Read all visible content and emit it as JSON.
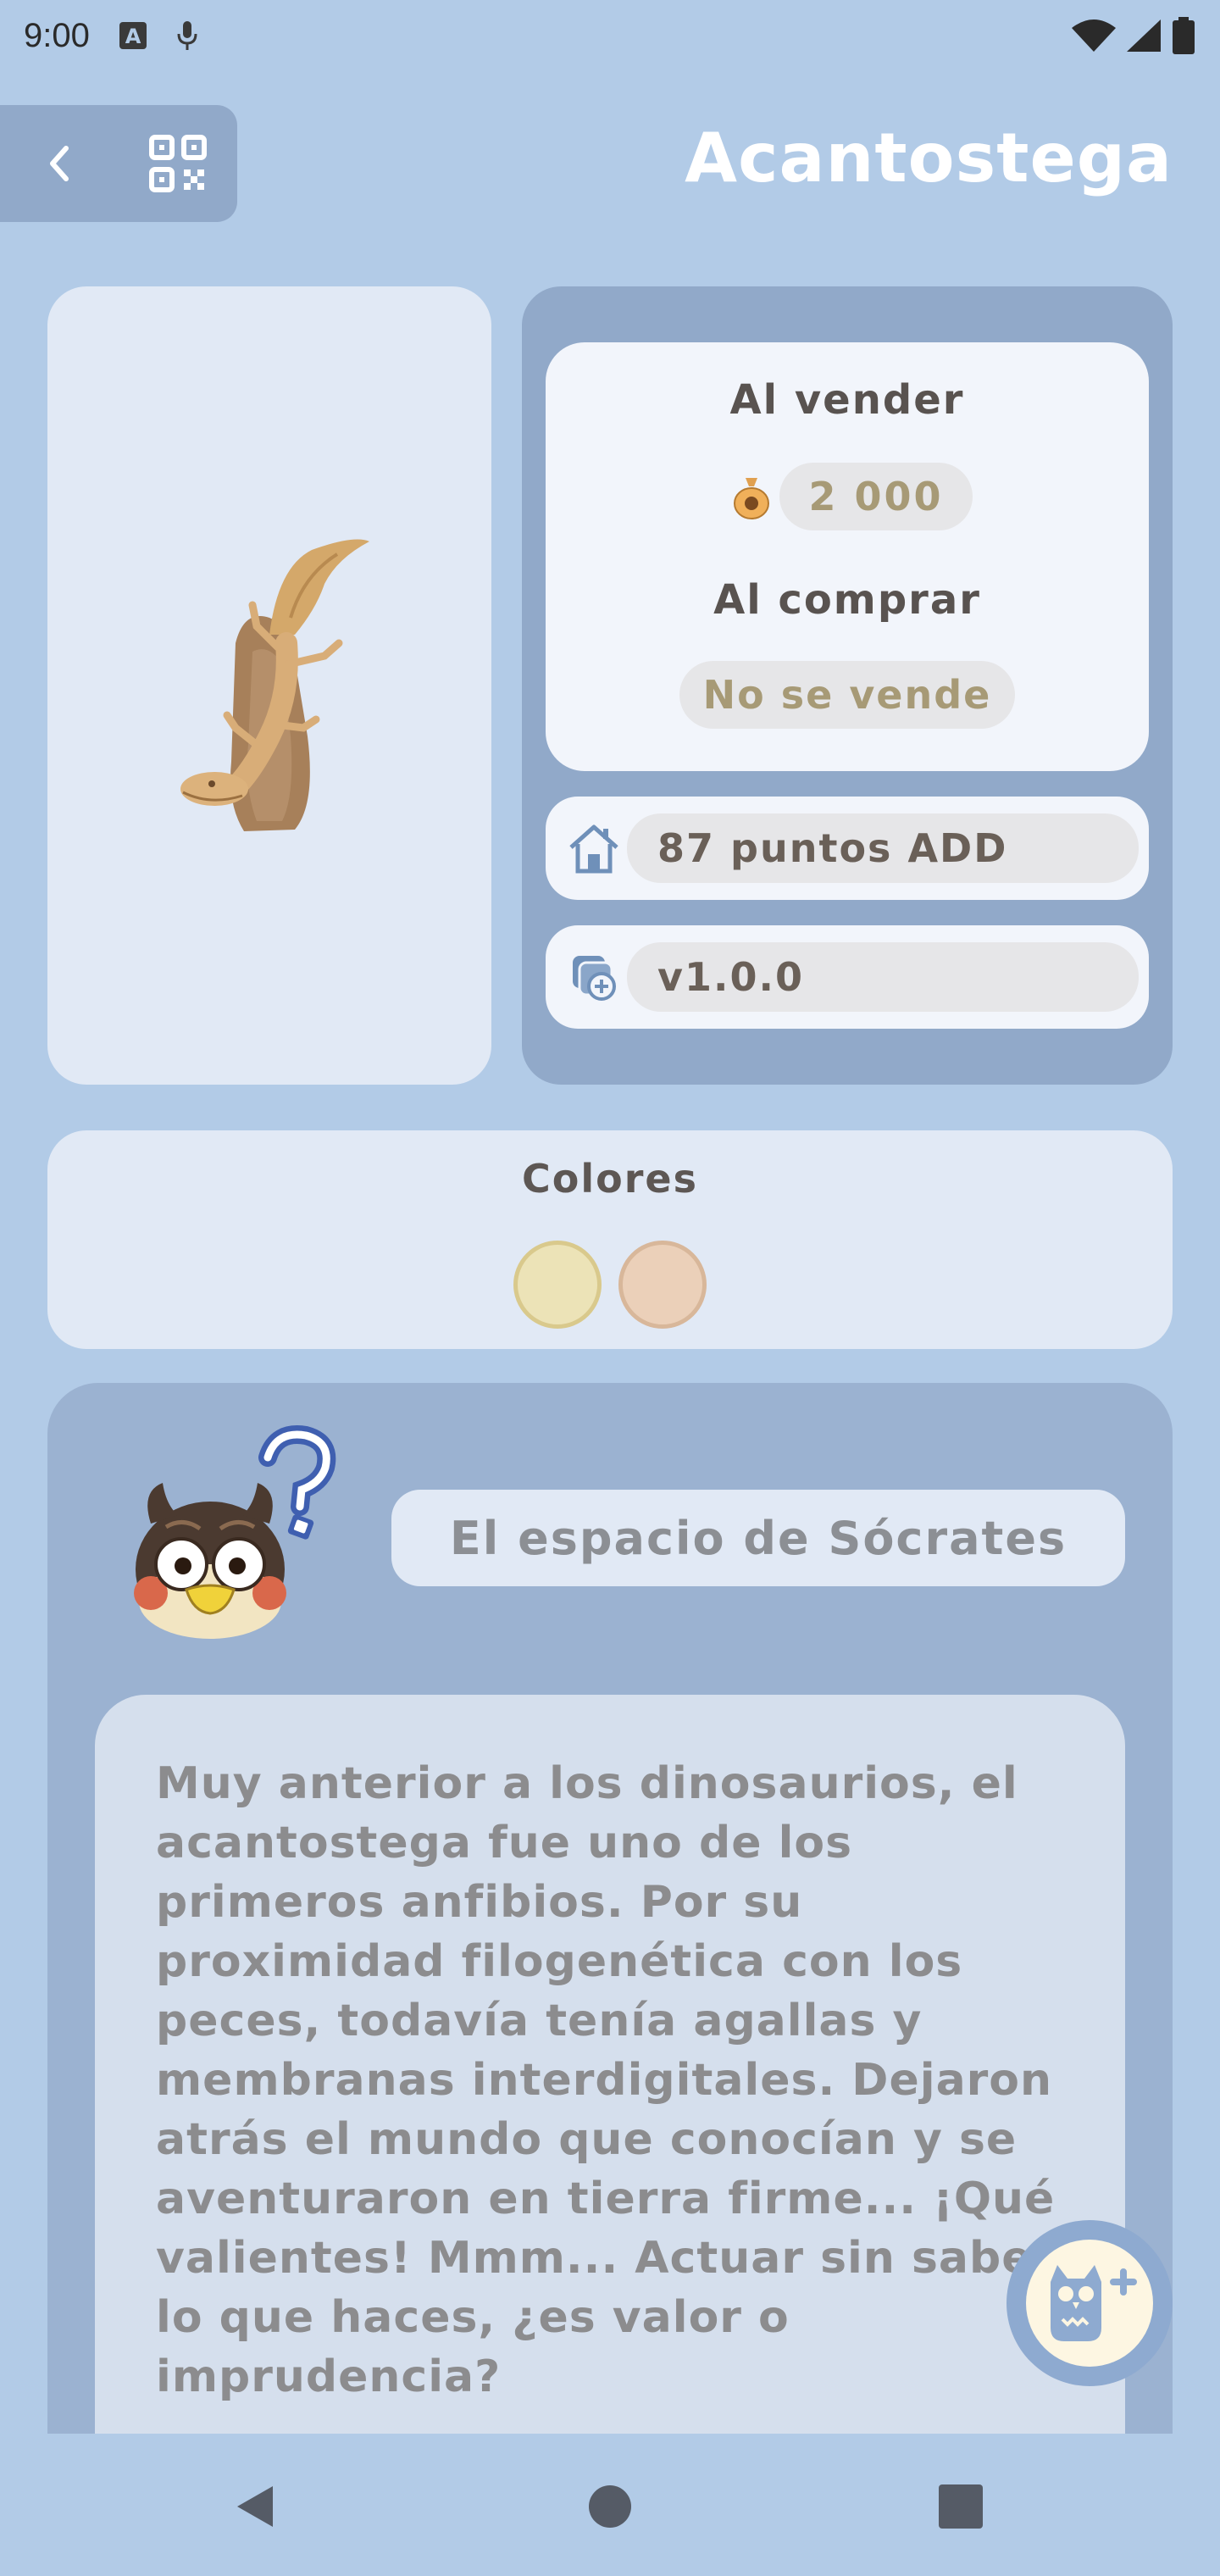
{
  "status_bar": {
    "time": "9:00",
    "icons": [
      "keyboard-a-icon",
      "mic-icon",
      "wifi-icon",
      "signal-icon",
      "battery-icon"
    ]
  },
  "header": {
    "title": "Acantostega",
    "back_icon": "chevron-left-icon",
    "qr_icon": "qr-code-icon"
  },
  "item": {
    "image_icon": "acanthostega-fossil-image",
    "sell_label": "Al vender",
    "sell_price": "2 000",
    "sell_icon": "bell-bag-icon",
    "buy_label": "Al comprar",
    "buy_value": "No se vende",
    "hha_points": "87 puntos ADD",
    "hha_icon": "house-icon",
    "version": "v1.0.0",
    "version_icon": "version-layers-icon"
  },
  "colors": {
    "title": "Colores",
    "swatches": [
      {
        "name": "yellow",
        "fill": "#ece3b7",
        "border": "#d9c98c"
      },
      {
        "name": "beige",
        "fill": "#ebd0b9",
        "border": "#d8b79a"
      }
    ]
  },
  "blathers": {
    "speaker": "El espacio de Sócrates",
    "quote": "Muy anterior a los dinosaurios, el acantostega fue uno de los primeros anfibios. Por su proximidad filogenética con los peces, todavía tenía agallas y membranas interdigitales. Dejaron atrás el mundo que conocían y se aventuraron en tierra firme... ¡Qué valientes! Mmm... Actuar sin saber lo que haces, ¿es valor o imprudencia?"
  },
  "fab": {
    "icon": "owl-add-icon"
  },
  "colors_theme": {
    "background": "#b2cbe7",
    "panel": "#91a9c9",
    "card": "#e1e9f5",
    "accent_text": "#a79a76"
  },
  "nav": {
    "back": "nav-back-icon",
    "home": "nav-home-icon",
    "recents": "nav-recents-icon"
  }
}
